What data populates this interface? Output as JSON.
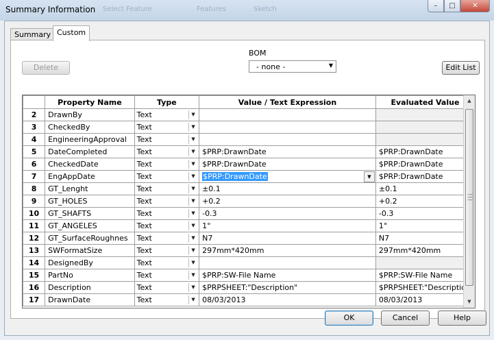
{
  "window": {
    "title": "Summary Information",
    "background_ghost": [
      "Select Feature",
      "Features",
      "Sketch"
    ],
    "controls": {
      "minimize": "–",
      "maximize": "□",
      "close": "✕"
    }
  },
  "tabs": [
    {
      "label": "Summary",
      "active": false
    },
    {
      "label": "Custom",
      "active": true
    }
  ],
  "toolbar": {
    "delete_label": "Delete",
    "bom_label": "BOM",
    "bom_value": "- none -",
    "edit_list_label": "Edit List"
  },
  "grid": {
    "headers": [
      "",
      "Property Name",
      "Type",
      "Value / Text Expression",
      "Evaluated Value"
    ],
    "rows": [
      {
        "num": "2",
        "name": "DrawnBy",
        "type": "Text",
        "value": "",
        "evaluated": ""
      },
      {
        "num": "3",
        "name": "CheckedBy",
        "type": "Text",
        "value": "",
        "evaluated": ""
      },
      {
        "num": "4",
        "name": "EngineeringApproval",
        "type": "Text",
        "value": "",
        "evaluated": ""
      },
      {
        "num": "5",
        "name": "DateCompleted",
        "type": "Text",
        "value": "$PRP:DrawnDate",
        "evaluated": "$PRP:DrawnDate"
      },
      {
        "num": "6",
        "name": "CheckedDate",
        "type": "Text",
        "value": "$PRP:DrawnDate",
        "evaluated": "$PRP:DrawnDate"
      },
      {
        "num": "7",
        "name": "EngAppDate",
        "type": "Text",
        "value": "$PRP:DrawnDate",
        "evaluated": "$PRP:DrawnDate",
        "selected": true
      },
      {
        "num": "8",
        "name": "GT_Lenght",
        "type": "Text",
        "value": "±0.1",
        "evaluated": "±0.1"
      },
      {
        "num": "9",
        "name": "GT_HOLES",
        "type": "Text",
        "value": "+0.2",
        "evaluated": "+0.2"
      },
      {
        "num": "10",
        "name": "GT_SHAFTS",
        "type": "Text",
        "value": "-0.3",
        "evaluated": "-0.3"
      },
      {
        "num": "11",
        "name": "GT_ANGELES",
        "type": "Text",
        "value": "1°",
        "evaluated": "1°"
      },
      {
        "num": "12",
        "name": "GT_SurfaceRoughnes",
        "type": "Text",
        "value": "N7",
        "evaluated": "N7"
      },
      {
        "num": "13",
        "name": "SWFormatSize",
        "type": "Text",
        "value": "297mm*420mm",
        "evaluated": "297mm*420mm"
      },
      {
        "num": "14",
        "name": "DesignedBy",
        "type": "Text",
        "value": "",
        "evaluated": ""
      },
      {
        "num": "15",
        "name": "PartNo",
        "type": "Text",
        "value": "$PRP:SW-File Name",
        "evaluated": "$PRP:SW-File Name"
      },
      {
        "num": "16",
        "name": "Description",
        "type": "Text",
        "value": "$PRPSHEET:\"Description\"",
        "evaluated": "$PRPSHEET:\"Description\""
      },
      {
        "num": "17",
        "name": "DrawnDate",
        "type": "Text",
        "value": "08/03/2013",
        "evaluated": "08/03/2013"
      }
    ]
  },
  "footer": {
    "ok_label": "OK",
    "cancel_label": "Cancel",
    "help_label": "Help"
  }
}
